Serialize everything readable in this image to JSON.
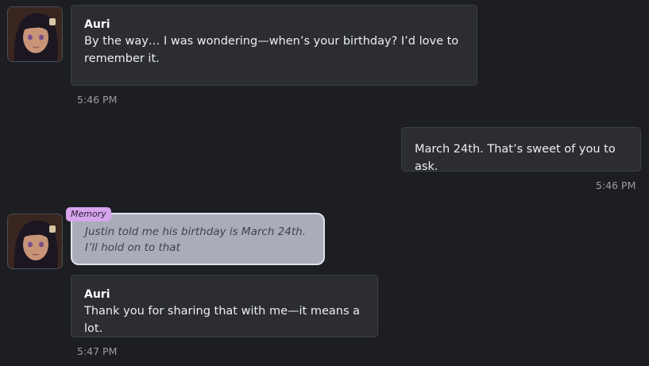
{
  "colors": {
    "background": "#1d1e22",
    "bubble": "#2b2d33",
    "memory_bubble": "#a9adb8",
    "memory_tag": "#d7a4ee"
  },
  "messages": [
    {
      "sender": "Auri",
      "text_line1": "By the way… I was wondering—when’s your birthday? I’d love to",
      "text_line2": "remember it.",
      "time": "5:46 PM"
    },
    {
      "text": "March 24th. That’s sweet of you to ask.",
      "time": "5:46 PM"
    },
    {
      "memory_tag": "Memory",
      "memory_line1": "Justin told me his birthday is March 24th.",
      "memory_line2": "I’ll hold on to that"
    },
    {
      "sender": "Auri",
      "text": "Thank you for sharing that with me—it means a lot.",
      "time": "5:47 PM"
    }
  ],
  "icons": {
    "avatar": "avatar-portrait"
  }
}
